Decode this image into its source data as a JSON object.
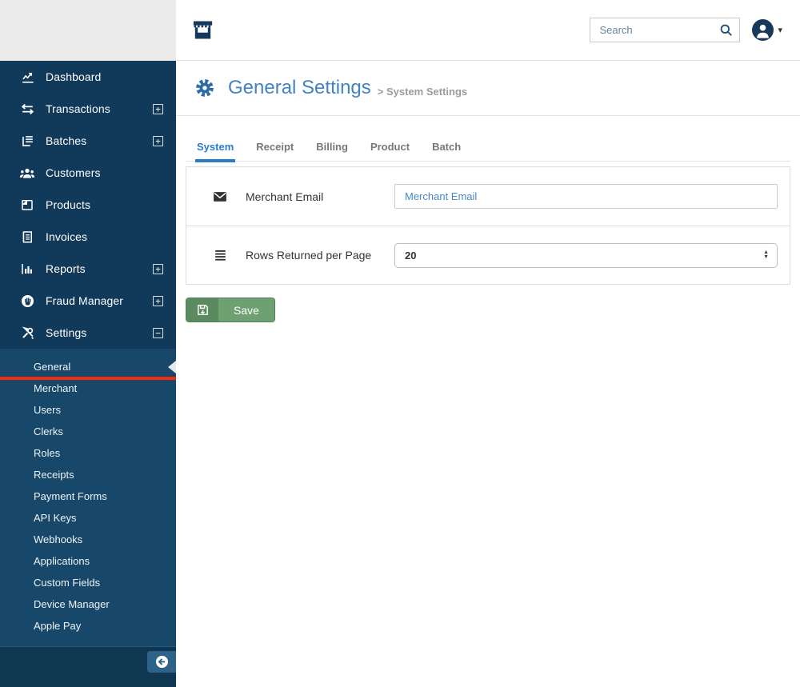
{
  "header": {
    "search_placeholder": "Search",
    "caret_glyph": "▾"
  },
  "sidebar": {
    "items": [
      {
        "label": "Dashboard"
      },
      {
        "label": "Transactions",
        "expand": "+"
      },
      {
        "label": "Batches",
        "expand": "+"
      },
      {
        "label": "Customers"
      },
      {
        "label": "Products"
      },
      {
        "label": "Invoices"
      },
      {
        "label": "Reports",
        "expand": "+"
      },
      {
        "label": "Fraud Manager",
        "expand": "+"
      },
      {
        "label": "Settings",
        "expand": "−"
      }
    ],
    "submenu": {
      "items": [
        "General",
        "Merchant",
        "Users",
        "Clerks",
        "Roles",
        "Receipts",
        "Payment Forms",
        "API Keys",
        "Webhooks",
        "Applications",
        "Custom Fields",
        "Device Manager",
        "Apple Pay"
      ],
      "active": "General"
    }
  },
  "page": {
    "title": "General Settings",
    "breadcrumb": "> System Settings",
    "tabs": [
      "System",
      "Receipt",
      "Billing",
      "Product",
      "Batch"
    ],
    "active_tab": "System"
  },
  "form": {
    "rows": [
      {
        "label": "Merchant Email",
        "placeholder": "Merchant Email",
        "value": ""
      },
      {
        "label": "Rows Returned per Page",
        "value": "20"
      }
    ],
    "save_label": "Save",
    "spinner_up": "▲",
    "spinner_down": "▼"
  },
  "colors": {
    "accent_red": "#f22b0e",
    "sidebar_bg": "#11395a",
    "sidebar_submenu_bg": "#17486a",
    "active_blue": "#2b7cc9",
    "title_blue": "#4283c3",
    "save_green": "#6fa072",
    "save_green_dark": "#5b8a61"
  }
}
